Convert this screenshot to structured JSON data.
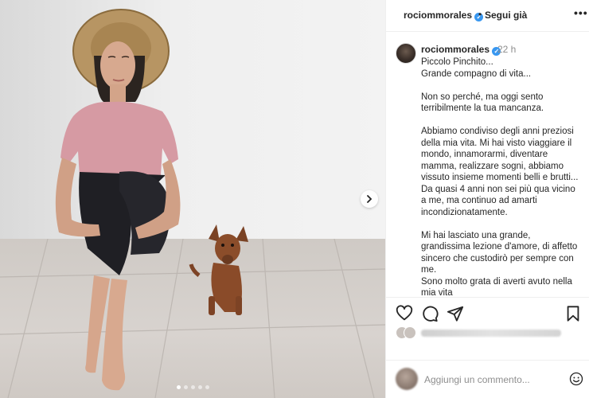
{
  "post": {
    "username": "rociommorales",
    "follow_label": "Segui già",
    "separator": "•",
    "more_label": "•••",
    "time": "22 h",
    "caption": {
      "p1_line1": "Piccolo Pinchito...",
      "p1_line2": "Grande compagno di vita...",
      "p2": "Non so perché, ma oggi sento terribilmente la tua mancanza.",
      "p3": "Abbiamo condiviso degli anni preziosi della mia vita. Mi hai visto viaggiare il mondo, innamorarmi, diventare mamma, realizzare sogni, abbiamo vissuto insieme momenti belli e brutti... Da quasi 4 anni non sei più qua vicino a me, ma continuo ad amarti incondizionatamente.",
      "p4_line1": "Mi hai lasciato una grande, grandissima lezione d'amore, di affetto sincero che custodirò per sempre con me.",
      "p4_line2": "Sono molto grata di averti avuto nella mia vita"
    },
    "carousel": {
      "slide_count": 5,
      "active_index": 0
    }
  },
  "actions": {
    "like_icon": "heart-icon",
    "comment_icon": "comment-icon",
    "share_icon": "send-icon",
    "save_icon": "bookmark-icon"
  },
  "comment_box": {
    "placeholder": "Aggiungi un commento...",
    "emoji_icon": "smiley-icon"
  },
  "colors": {
    "verified": "#3897f0",
    "text_primary": "#262626",
    "text_secondary": "#8e8e8e",
    "border": "#efefef"
  }
}
